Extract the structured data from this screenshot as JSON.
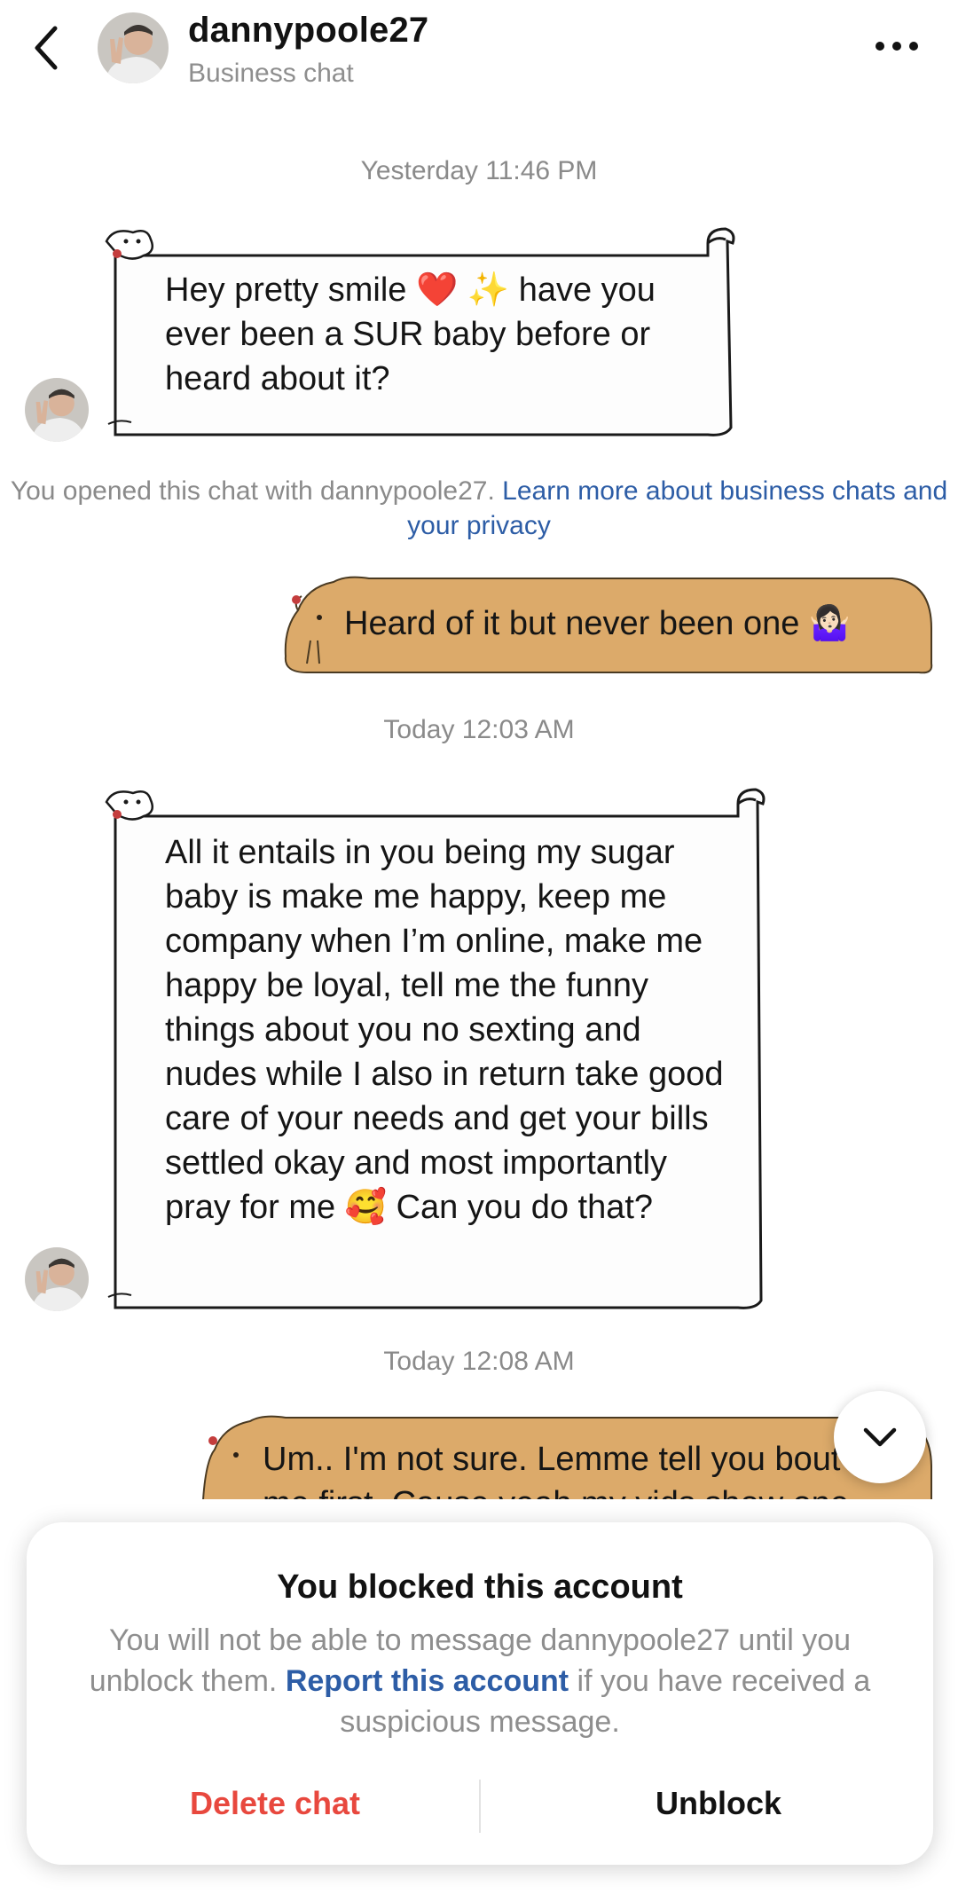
{
  "header": {
    "username": "dannypoole27",
    "subtitle": "Business chat",
    "back_icon": "chevron-left-icon",
    "more_icon": "more-horizontal-icon"
  },
  "chat": {
    "stamp1": "Yesterday 11:46 PM",
    "msg1": "Hey pretty smile ❤️ ✨ have you ever been a SUR baby before or heard about it?",
    "notice_text": "You opened this chat with dannypoole27. ",
    "notice_link": "Learn more about business chats and your privacy",
    "msg2": "Heard of it but never been one 🤷🏻‍♀️",
    "stamp2": "Today 12:03 AM",
    "msg3": "All it entails in you being my sugar baby is make me happy, keep me company when I’m online, make me happy be loyal, tell me the funny things about you no sexting and nudes while I also in return take good care of your needs and get your bills settled okay and most importantly pray for me 🥰 Can you do that?",
    "stamp3": "Today 12:08 AM",
    "msg4": "Um.. I'm not sure. Lemme tell you bout me first. Cause yeah my vids show one",
    "scroll_icon": "chevron-down-icon"
  },
  "blocked": {
    "title": "You blocked this account",
    "body_before": "You will not be able to message dannypoole27 until you unblock them. ",
    "report_link": "Report this account",
    "body_after": " if you have received a suspicious message.",
    "delete_label": "Delete chat",
    "unblock_label": "Unblock"
  },
  "colors": {
    "link": "#2d5da6",
    "danger": "#e8483e",
    "capybara_bubble": "#dcaa6a",
    "muted": "#8e8e8e"
  }
}
